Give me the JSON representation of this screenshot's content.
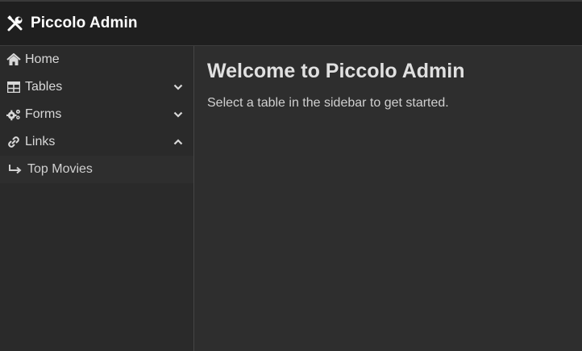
{
  "header": {
    "title": "Piccolo Admin",
    "logo_icon": "tools-icon"
  },
  "sidebar": {
    "items": [
      {
        "label": "Home",
        "icon": "home-icon",
        "chevron": null
      },
      {
        "label": "Tables",
        "icon": "table-icon",
        "chevron": "chevron-down-icon"
      },
      {
        "label": "Forms",
        "icon": "gears-icon",
        "chevron": "chevron-down-icon"
      },
      {
        "label": "Links",
        "icon": "link-icon",
        "chevron": "chevron-up-icon"
      }
    ],
    "links_submenu": [
      {
        "label": "Top Movies",
        "icon": "arrow-turn-right-icon"
      }
    ]
  },
  "main": {
    "heading": "Welcome to Piccolo Admin",
    "message": "Select a table in the sidebar to get started."
  },
  "colors": {
    "header_bg": "#1f1f1f",
    "sidebar_bg": "#2a2a2a",
    "main_bg": "#2e2e2e",
    "text": "#d4d4d4"
  }
}
